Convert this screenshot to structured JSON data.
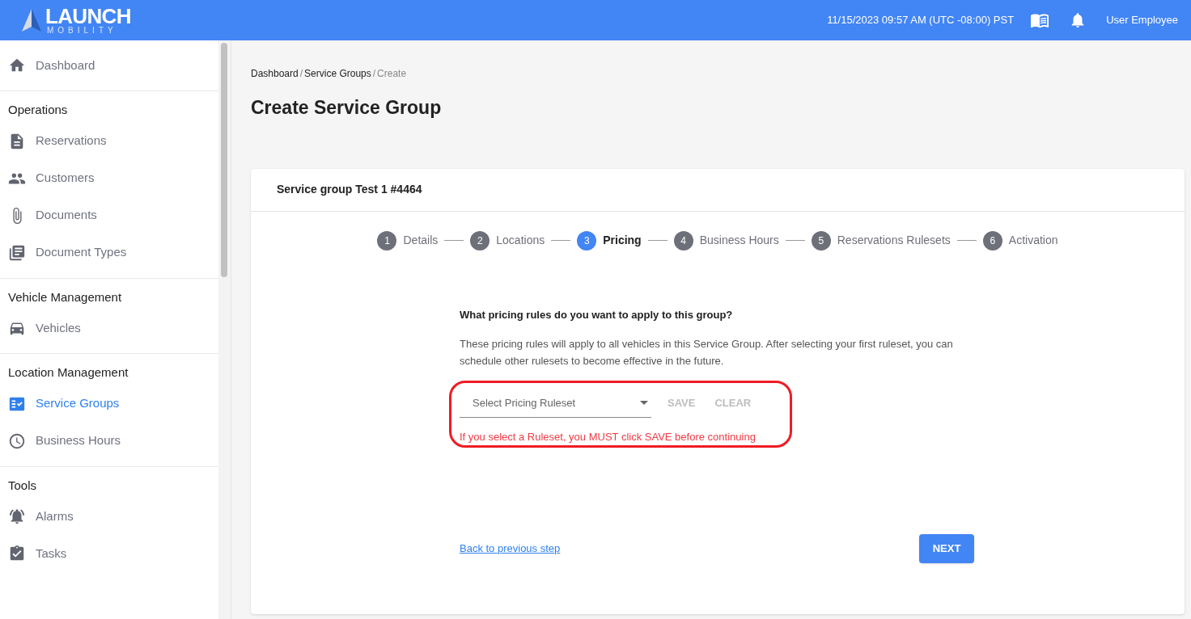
{
  "header": {
    "logo": {
      "title": "LAUNCH",
      "subtitle": "MOBILITY"
    },
    "datetime": "11/15/2023 09:57 AM (UTC -08:00) PST",
    "user": "User Employee"
  },
  "sidebar": {
    "sections": [
      {
        "items": [
          {
            "label": "Dashboard",
            "selected": false
          }
        ]
      },
      {
        "heading": "Operations",
        "items": [
          {
            "label": "Reservations",
            "selected": false
          },
          {
            "label": "Customers",
            "selected": false
          },
          {
            "label": "Documents",
            "selected": false
          },
          {
            "label": "Document Types",
            "selected": false
          }
        ]
      },
      {
        "heading": "Vehicle Management",
        "items": [
          {
            "label": "Vehicles",
            "selected": false
          }
        ]
      },
      {
        "heading": "Location Management",
        "items": [
          {
            "label": "Service Groups",
            "selected": true
          },
          {
            "label": "Business Hours",
            "selected": false
          }
        ]
      },
      {
        "heading": "Tools",
        "items": [
          {
            "label": "Alarms",
            "selected": false
          },
          {
            "label": "Tasks",
            "selected": false
          }
        ]
      }
    ]
  },
  "breadcrumb": [
    {
      "label": "Dashboard"
    },
    {
      "separator": "/",
      "label": "Service Groups"
    },
    {
      "separator": "/",
      "label": "Create"
    }
  ],
  "page_title": "Create Service Group",
  "card": {
    "title": "Service group Test 1 #4464",
    "steps": [
      {
        "number": "1",
        "label": "Details",
        "selected": false
      },
      {
        "number": "2",
        "label": "Locations",
        "selected": false
      },
      {
        "number": "3",
        "label": "Pricing",
        "selected": true
      },
      {
        "number": "4",
        "label": "Business Hours",
        "selected": false
      },
      {
        "number": "5",
        "label": "Reservations Rulesets",
        "selected": false
      },
      {
        "number": "6",
        "label": "Activation",
        "selected": false
      }
    ],
    "question": "What pricing rules do you want to apply to this group?",
    "description": "These pricing rules will apply to all vehicles in this Service Group. After selecting your first ruleset, you can schedule other rulesets to become effective in the future.",
    "select": {
      "placeholder": "Select Pricing Ruleset"
    },
    "actions": [
      {
        "label": "SAVE",
        "disabled": true
      },
      {
        "label": "CLEAR",
        "disabled": true
      }
    ],
    "warning": "If you select a Ruleset, you MUST click SAVE before continuing",
    "back_link": "Back to previous step",
    "next_button": "NEXT"
  }
}
